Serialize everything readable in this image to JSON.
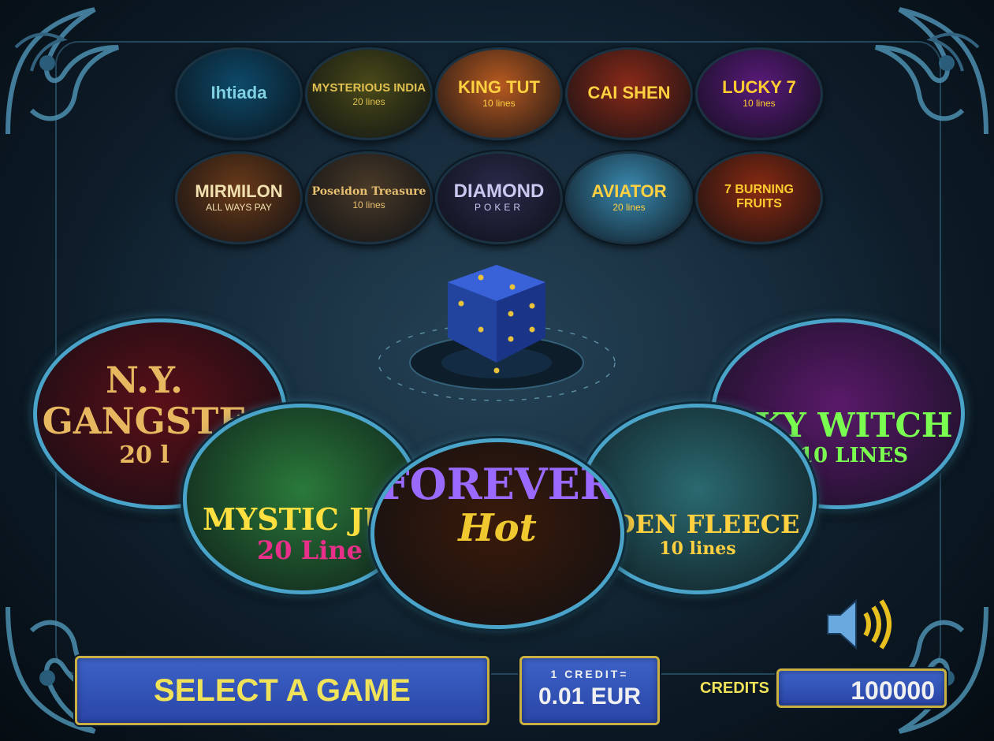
{
  "small_games": [
    {
      "title": "Ihtiada",
      "subtitle": "",
      "bg": "#0d4a6a",
      "fg": "#7fd0e0"
    },
    {
      "title": "MYSTERIOUS INDIA",
      "subtitle": "20 lines",
      "bg": "#4a4a18",
      "fg": "#e0c050"
    },
    {
      "title": "KING TUT",
      "subtitle": "10 lines",
      "bg": "#b85a20",
      "fg": "#ffd040"
    },
    {
      "title": "CAI SHEN",
      "subtitle": "",
      "bg": "#8a2a18",
      "fg": "#ffd040"
    },
    {
      "title": "LUCKY 7",
      "subtitle": "10 lines",
      "bg": "#5a1a7a",
      "fg": "#ffcc30"
    },
    {
      "title": "MIRMILON",
      "subtitle": "ALL WAYS PAY",
      "bg": "#6a3a18",
      "fg": "#f0e0b0"
    },
    {
      "title": "Poseidon Treasure",
      "subtitle": "10 lines",
      "bg": "#4a3a28",
      "fg": "#e8c070"
    },
    {
      "title": "DIAMOND",
      "subtitle": "POKER",
      "bg": "#2a2a4a",
      "fg": "#c8c8f0"
    },
    {
      "title": "AVIATOR",
      "subtitle": "20 lines",
      "bg": "#3a8ab0",
      "fg": "#ffd040"
    },
    {
      "title": "7 BURNING FRUITS",
      "subtitle": "",
      "bg": "#8a2a10",
      "fg": "#ffcc30"
    }
  ],
  "big_games": [
    {
      "title": "N.Y. GANGSTE",
      "subtitle": "20 l",
      "bg": "#5a0f18",
      "fg": "#e8b860"
    },
    {
      "title": "KY WITCH",
      "subtitle": "10 LINES",
      "bg": "#5a1a6a",
      "fg": "#7aff50"
    },
    {
      "title": "MYSTIC JUN",
      "subtitle": "20 Line",
      "bg": "#2a7a3a",
      "fg": "#ffe040"
    },
    {
      "title": "LDEN FLEECE",
      "subtitle": "10 lines",
      "bg": "#2a6a70",
      "fg": "#ffd040"
    },
    {
      "title": "FOREVER",
      "subtitle": "Hot",
      "bg": "#3a1a0a",
      "fg": "#9a6aff"
    }
  ],
  "bottom": {
    "select_label": "SELECT A GAME",
    "credit_line1": "1 CREDIT=",
    "credit_line2": "0.01 EUR",
    "credits_label": "CREDITS",
    "credits_value": "100000"
  },
  "icons": {
    "dice": "dice-icon",
    "sound": "speaker-icon"
  },
  "colors": {
    "bar_bg": "#2f4fb8",
    "bar_border": "#c9b040",
    "bar_text": "#f0e35a"
  }
}
